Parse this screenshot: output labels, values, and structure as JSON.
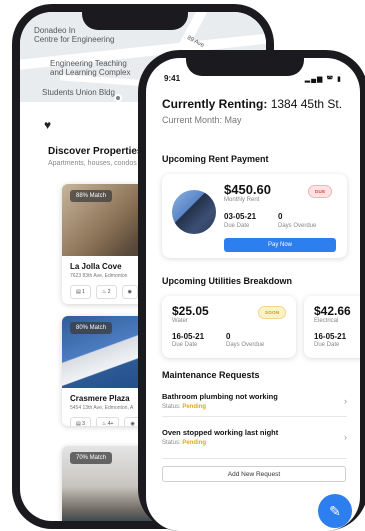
{
  "back_app": {
    "map": {
      "labels": [
        "Donadeo In",
        "Centre for Engineering",
        "Engineering Teaching",
        "and Learning Complex",
        "Students Union Bldg"
      ],
      "street": "89 Ave"
    },
    "heart_icon": "heart-icon",
    "discover_title": "Discover Properties",
    "discover_subtitle": "Apartments, houses, condos",
    "properties": [
      {
        "match": "88% Match",
        "name": "La Jolla Cove",
        "address": "7623 83th Ave, Edmonton",
        "beds": "1",
        "baths": "2"
      },
      {
        "match": "80% Match",
        "name": "Crasmere Plaza",
        "address": "5454 13th Ave, Edmonton, A",
        "beds": "3",
        "baths": "4+"
      },
      {
        "match": "70% Match"
      }
    ]
  },
  "front_app": {
    "status": {
      "time": "9:41",
      "icons": "signal wifi battery"
    },
    "renting_prefix": "Currently Renting:",
    "renting_address": "1384 45th St.",
    "current_month": "Current Month: May",
    "rent": {
      "title": "Upcoming Rent Payment",
      "amount": "$450.60",
      "amount_label": "Monthly Rent",
      "badge": "DUE",
      "due_date": "03-05-21",
      "due_date_label": "Due Date",
      "days_overdue": "0",
      "days_overdue_label": "Days Overdue",
      "pay_label": "Pay Now"
    },
    "utilities": {
      "title": "Upcoming Utilities Breakdown",
      "items": [
        {
          "amount": "$25.05",
          "type": "Water",
          "badge": "SOON",
          "due_date": "16-05-21",
          "due_date_label": "Due Date",
          "days_overdue": "0",
          "days_overdue_label": "Days Overdue"
        },
        {
          "amount": "$42.66",
          "type": "Electrical",
          "due_date": "16-05-21",
          "due_date_label": "Due Date"
        }
      ]
    },
    "maintenance": {
      "title": "Maintenance Requests",
      "items": [
        {
          "title": "Bathroom plumbing not working",
          "status_label": "Status:",
          "status": "Pending"
        },
        {
          "title": "Oven stopped working last night",
          "status_label": "Status:",
          "status": "Pending"
        }
      ],
      "add_label": "Add New Request"
    },
    "fab_icon": "pencil-icon",
    "colors": {
      "accent": "#2d7ff0",
      "pending": "#e0a81a",
      "due": "#d64545"
    }
  }
}
